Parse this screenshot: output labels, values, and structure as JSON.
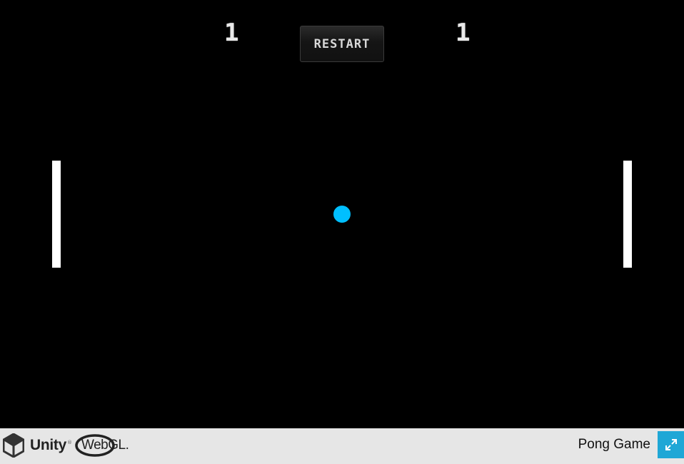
{
  "game": {
    "score_left": "1",
    "score_right": "1",
    "restart_label": "RESTART",
    "ball_color": "#00bfff",
    "paddle_color": "#ffffff",
    "background_color": "#000000"
  },
  "footer": {
    "unity_label": "Unity",
    "unity_tm": "®",
    "webgl_label": "WebGL.",
    "title": "Pong Game",
    "fullscreen_icon": "fullscreen-expand-icon",
    "accent_color": "#1fa7d6"
  }
}
